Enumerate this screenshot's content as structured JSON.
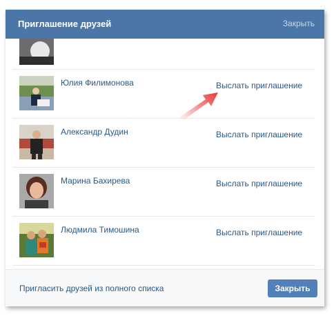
{
  "dialog": {
    "title": "Приглашение друзей",
    "close_label": "Закрыть"
  },
  "friends": [
    {
      "name": "Юлия Филимонова",
      "action": "Выслать приглашение"
    },
    {
      "name": "Александр Дудин",
      "action": "Выслать приглашение"
    },
    {
      "name": "Марина Бахирева",
      "action": "Выслать приглашение"
    },
    {
      "name": "Людмила Тимошина",
      "action": "Выслать приглашение"
    }
  ],
  "footer": {
    "invite_all_label": "Пригласить друзей из полного списка",
    "close_button_label": "Закрыть"
  },
  "colors": {
    "header_bg": "#4a76a8",
    "link": "#2a5885",
    "button_bg": "#5181b8",
    "arrow": "#e53935"
  }
}
